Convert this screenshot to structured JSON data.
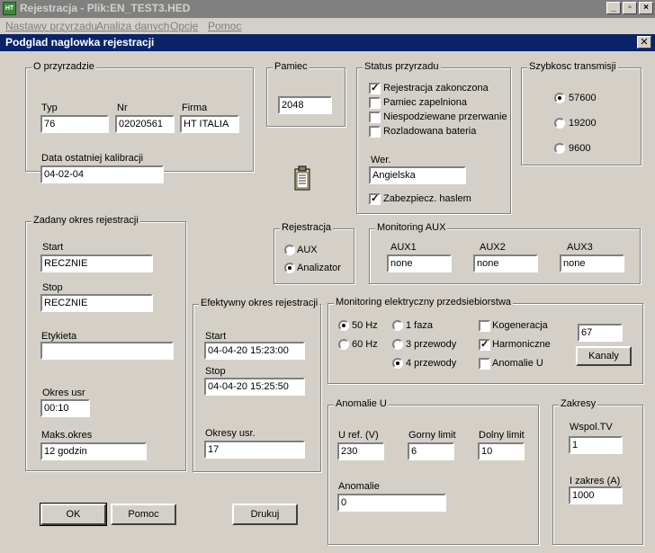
{
  "window": {
    "title": "Rejestracja - Plik:EN_TEST3.HED",
    "app_icon": "app-logo-icon"
  },
  "menu": [
    "Nastawy przyrzadu",
    "Analiza danych",
    "Opcje",
    "Pomoc"
  ],
  "dialog": {
    "title": "Podglad naglowka rejestracji"
  },
  "device": {
    "legend": "O przyrzadzie",
    "typ_label": "Typ",
    "typ_value": "76",
    "nr_label": "Nr",
    "nr_value": "02020561",
    "firma_label": "Firma",
    "firma_value": "HT ITALIA",
    "cal_label": "Data ostatniej kalibracji",
    "cal_value": "04-02-04"
  },
  "memory": {
    "legend": "Pamiec",
    "value": "2048"
  },
  "status": {
    "legend": "Status przyrzadu",
    "items": [
      {
        "label": "Rejestracja zakonczona",
        "checked": true
      },
      {
        "label": "Pamiec zapelniona",
        "checked": false
      },
      {
        "label": "Niespodziewane przerwanie",
        "checked": false
      },
      {
        "label": "Rozladowana bateria",
        "checked": false
      }
    ],
    "wer_label": "Wer.",
    "wer_value": "Angielska",
    "password_label": "Zabezpiecz. haslem",
    "password_checked": true
  },
  "baud": {
    "legend": "Szybkosc transmisji",
    "options": [
      "57600",
      "19200",
      "9600"
    ],
    "selected": "57600"
  },
  "set_period": {
    "legend": "Zadany okres rejestracji",
    "start_label": "Start",
    "start_value": "RECZNIE",
    "stop_label": "Stop",
    "stop_value": "RECZNIE",
    "tag_label": "Etykieta",
    "tag_value": "",
    "period_label": "Okres usr",
    "period_value": "00:10",
    "max_label": "Maks.okres",
    "max_value": "12 godzin"
  },
  "registration": {
    "legend": "Rejestracja",
    "options": [
      "AUX",
      "Analizator"
    ],
    "selected": "Analizator"
  },
  "aux": {
    "legend": "Monitoring AUX",
    "labels": [
      "AUX1",
      "AUX2",
      "AUX3"
    ],
    "values": [
      "none",
      "none",
      "none"
    ]
  },
  "eff_period": {
    "legend": "Efektywny okres rejestracji",
    "start_label": "Start",
    "start_value": "04-04-20  15:23:00",
    "stop_label": "Stop",
    "stop_value": "04-04-20  15:25:50",
    "periods_label": "Okresy usr.",
    "periods_value": "17"
  },
  "elec": {
    "legend": "Monitoring elektryczny przedsiebiorstwa",
    "freq": [
      "50 Hz",
      "60 Hz"
    ],
    "freq_selected": "50 Hz",
    "wires": [
      "1 faza",
      "3 przewody",
      "4 przewody"
    ],
    "wires_selected": "4 przewody",
    "checks": [
      {
        "label": "Kogeneracja",
        "checked": false
      },
      {
        "label": "Harmoniczne",
        "checked": true
      },
      {
        "label": "Anomalie U",
        "checked": false
      }
    ],
    "channels_value": "67",
    "channels_button": "Kanaly"
  },
  "anomalies": {
    "legend": "Anomalie U",
    "uref_label": "U ref. (V)",
    "uref_value": "230",
    "upper_label": "Gorny limit",
    "upper_value": "6",
    "lower_label": "Dolny limit",
    "lower_value": "10",
    "count_label": "Anomalie",
    "count_value": "0"
  },
  "ranges": {
    "legend": "Zakresy",
    "tv_label": "Wspol.TV",
    "tv_value": "1",
    "i_label": "I zakres (A)",
    "i_value": "1000"
  },
  "buttons": {
    "ok": "OK",
    "pomoc": "Pomoc",
    "drukuj": "Drukuj"
  }
}
